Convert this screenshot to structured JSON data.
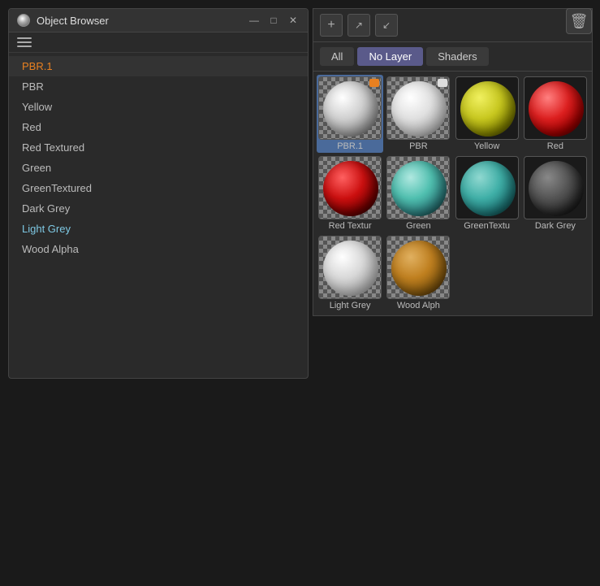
{
  "window": {
    "title": "Object Browser",
    "controls": {
      "minimize": "—",
      "maximize": "□",
      "close": "✕"
    }
  },
  "list": {
    "items": [
      {
        "label": "PBR.1",
        "selected": true
      },
      {
        "label": "PBR",
        "selected": false
      },
      {
        "label": "Yellow",
        "selected": false
      },
      {
        "label": "Red",
        "selected": false
      },
      {
        "label": "Red Textured",
        "selected": false
      },
      {
        "label": "Green",
        "selected": false
      },
      {
        "label": "GreenTextured",
        "selected": false
      },
      {
        "label": "Dark Grey",
        "selected": false
      },
      {
        "label": "Light Grey",
        "selected": false
      },
      {
        "label": "Wood Alpha",
        "selected": false
      }
    ]
  },
  "right_panel": {
    "tabs": [
      {
        "label": "All",
        "active": false
      },
      {
        "label": "No Layer",
        "active": true
      },
      {
        "label": "Shaders",
        "active": false
      }
    ],
    "materials": [
      {
        "name": "PBR.1",
        "type": "white_sphere",
        "selected": true,
        "badge": "orange"
      },
      {
        "name": "PBR",
        "type": "white_sphere_2",
        "selected": false,
        "badge": "white"
      },
      {
        "name": "Yellow",
        "type": "yellow_sphere",
        "selected": false
      },
      {
        "name": "Red",
        "type": "red_sphere",
        "selected": false
      },
      {
        "name": "Red Textur",
        "type": "red_sphere_2",
        "selected": false
      },
      {
        "name": "Green",
        "type": "teal_sphere",
        "selected": false
      },
      {
        "name": "GreenTextu",
        "type": "greentextured_sphere",
        "selected": false
      },
      {
        "name": "Dark Grey",
        "type": "dark_sphere",
        "selected": false
      },
      {
        "name": "Light Grey",
        "type": "light_sphere",
        "selected": false
      },
      {
        "name": "Wood Alph",
        "type": "wood_sphere",
        "selected": false
      }
    ],
    "delete_label": "🗑"
  }
}
